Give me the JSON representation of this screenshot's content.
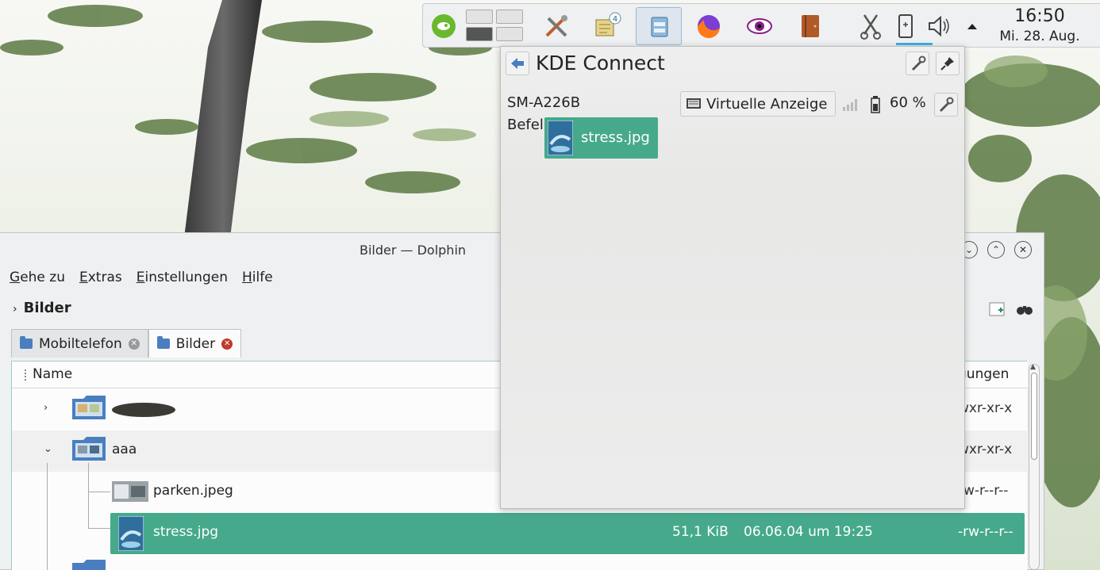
{
  "panel": {
    "icons": [
      {
        "name": "opensuse-icon"
      },
      {
        "name": "pager"
      },
      {
        "name": "tools-icon"
      },
      {
        "name": "notes-icon",
        "badge": "4"
      },
      {
        "name": "dolphin-task-icon"
      },
      {
        "name": "firefox-icon"
      },
      {
        "name": "eye-icon"
      },
      {
        "name": "book-icon"
      },
      {
        "name": "scissors-icon"
      },
      {
        "name": "kdeconnect-tray-icon"
      },
      {
        "name": "volume-icon"
      },
      {
        "name": "tray-expand-icon"
      }
    ],
    "clock_time": "16:50",
    "clock_date": "Mi. 28. Aug."
  },
  "dolphin": {
    "title": "Bilder — Dolphin",
    "menu": [
      "Gehe zu",
      "Extras",
      "Einstellungen",
      "Hilfe"
    ],
    "breadcrumb": "Bilder",
    "tabs": [
      {
        "label": "Mobiltelefon",
        "active": false
      },
      {
        "label": "Bilder",
        "active": true
      }
    ],
    "columns": {
      "name": "Name",
      "permissions": "gungen"
    },
    "rows": [
      {
        "label": "",
        "permissions": "wxr-xr-x",
        "expander": "›"
      },
      {
        "label": "aaa",
        "permissions": "wxr-xr-x",
        "expander": "⌄"
      },
      {
        "label": "parken.jpeg",
        "permissions": "rw-r--r--"
      },
      {
        "label": "stress.jpg",
        "size": "51,1 KiB",
        "modified": "06.06.04 um 19:25",
        "permissions": "-rw-r--r--"
      }
    ]
  },
  "kdeconnect": {
    "title": "KDE Connect",
    "device": "SM-A226B",
    "virtual_display": "Virtuelle Anzeige",
    "battery": "60 %",
    "commands": "Befel",
    "drag_file": "stress.jpg"
  },
  "colors": {
    "accent": "#46a98c",
    "highlight_blue": "#3daee9",
    "folder_blue": "#4a7ec0"
  }
}
